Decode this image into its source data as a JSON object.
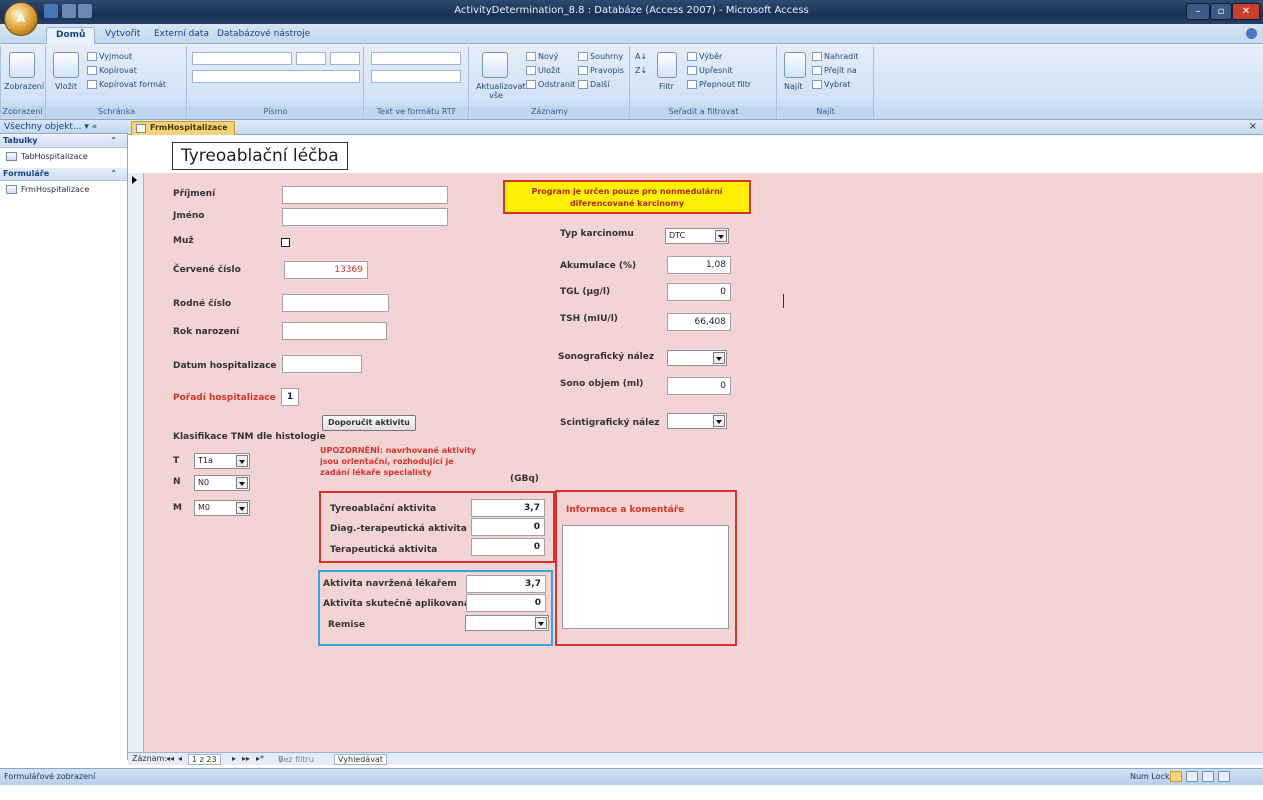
{
  "window": {
    "title": "ActivityDetermination_8.8 : Databáze (Access 2007) - Microsoft Access",
    "office_button": "A"
  },
  "tabs": [
    "Domů",
    "Vytvořit",
    "Externí data",
    "Databázové nástroje"
  ],
  "ribbon": {
    "zobrazeni": {
      "button": "Zobrazení",
      "group": "Zobrazení"
    },
    "schranka": {
      "paste": "Vložit",
      "cut": "Vyjmout",
      "copy": "Kopírovat",
      "format": "Kopírovat formát",
      "group": "Schránka"
    },
    "pismo": {
      "group": "Písmo"
    },
    "rtf": {
      "group": "Text ve formátu RTF"
    },
    "zaznamy": {
      "refresh": "Aktualizovat vše",
      "new": "Nový",
      "save": "Uložit",
      "delete": "Odstranit",
      "totals": "Souhrny",
      "spelling": "Pravopis",
      "more": "Další",
      "group": "Záznamy"
    },
    "filtr": {
      "filter": "Filtr",
      "selection": "Výběr",
      "advanced": "Upřesnit",
      "toggle": "Přepnout filtr",
      "group": "Seřadit a filtrovat"
    },
    "najit": {
      "find": "Najít",
      "replace": "Nahradit",
      "goto": "Přejít na",
      "select": "Vybrat",
      "group": "Najít"
    }
  },
  "nav": {
    "header": "Všechny objekt...",
    "groups": [
      {
        "label": "Tabulky",
        "items": [
          "TabHospitalizace"
        ]
      },
      {
        "label": "Formuláře",
        "items": [
          "FrmHospitalizace"
        ]
      }
    ]
  },
  "doc_tab": "FrmHospitalizace",
  "form": {
    "title": "Tyreoablační léčba",
    "fields": {
      "prijmeni": {
        "label": "Příjmení",
        "value": ""
      },
      "jmeno": {
        "label": "Jméno",
        "value": ""
      },
      "muz": {
        "label": "Muž"
      },
      "cervene_cislo": {
        "label": "Červené číslo",
        "value": "13369"
      },
      "rodne_cislo": {
        "label": "Rodné číslo",
        "value": ""
      },
      "rok_narozeni": {
        "label": "Rok narození",
        "value": ""
      },
      "datum_hosp": {
        "label": "Datum hospitalizace",
        "value": ""
      },
      "poradi_hosp": {
        "label": "Pořadí hospitalizace",
        "value": "1"
      }
    },
    "button_doporucit": "Doporučit aktivitu",
    "tnm": {
      "label": "Klasifikace TNM dle histologie",
      "t": {
        "label": "T",
        "value": "T1a"
      },
      "n": {
        "label": "N",
        "value": "N0"
      },
      "m": {
        "label": "M",
        "value": "M0"
      }
    },
    "warning": [
      "UPOZORNĚNÍ: navrhované aktivity",
      "jsou orientační, rozhodující je",
      "zadání lékaře specialisty"
    ],
    "gbq_unit": "(GBq)",
    "activities": {
      "tyreo": {
        "label": "Tyreoablační aktivita",
        "value": "3,7"
      },
      "diag": {
        "label": "Diag.-terapeutická aktivita",
        "value": "0"
      },
      "terap": {
        "label": "Terapeutická aktivita",
        "value": "0"
      }
    },
    "applied": {
      "navrzena": {
        "label": "Aktivita navržená lékařem",
        "value": "3,7"
      },
      "aplikovana": {
        "label": "Aktivita skutečně aplikovaná",
        "value": "0"
      },
      "remise": {
        "label": "Remise",
        "value": ""
      }
    },
    "notice": [
      "Program je určen pouze pro nonmedulární",
      "diferencované karcinomy"
    ],
    "right": {
      "typ": {
        "label": "Typ karcinomu",
        "value": "DTC"
      },
      "akumulace": {
        "label": "Akumulace (%)",
        "value": "1,08"
      },
      "tgl": {
        "label": "TGL (µg/l)",
        "value": "0"
      },
      "tsh": {
        "label": "TSH (mIU/l)",
        "value": "66,408"
      },
      "sono_nalez": {
        "label": "Sonografický nález",
        "value": ""
      },
      "sono_objem": {
        "label": "Sono objem (ml)",
        "value": "0"
      },
      "scinti": {
        "label": "Scintigrafický nález",
        "value": ""
      }
    },
    "comments_label": "Informace a komentáře"
  },
  "record_nav": {
    "label": "Záznam:",
    "position": "1 z 23",
    "no_filter": "Bez filtru",
    "search": "Vyhledávat"
  },
  "status": {
    "left": "Formulářové zobrazení",
    "right": "Num Lock"
  },
  "colors": {
    "form_bg": "#f3d4d5",
    "red_border": "#d8322a",
    "blue_border": "#35a8df",
    "notice_bg": "#ffef00"
  }
}
